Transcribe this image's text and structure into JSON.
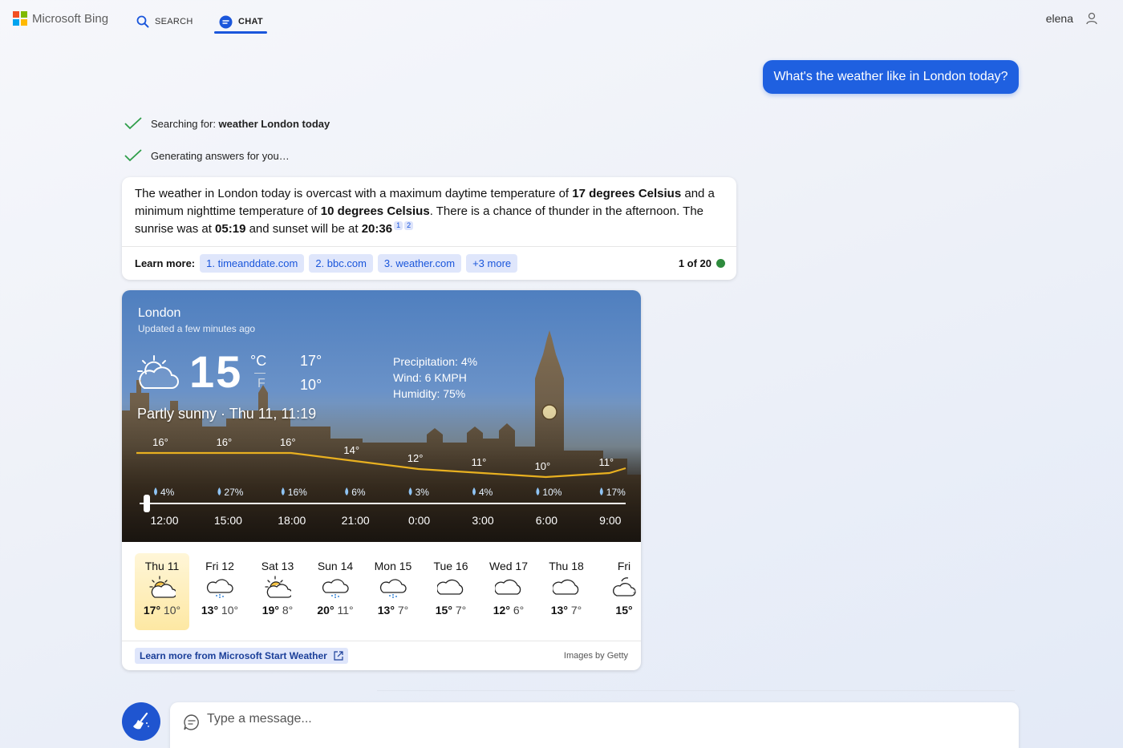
{
  "header": {
    "brand": "Microsoft Bing",
    "brand_colors": [
      "#f25022",
      "#7fba00",
      "#00a4ef",
      "#ffb900"
    ],
    "tabs": [
      {
        "label": "SEARCH",
        "icon": "search-icon"
      },
      {
        "label": "CHAT",
        "icon": "chat-icon",
        "active": true
      }
    ],
    "user_name": "elena"
  },
  "conversation": {
    "user_message": "What's the weather like in London today?",
    "status": [
      {
        "prefix": "Searching for: ",
        "bold": "weather London today"
      },
      {
        "prefix": "Generating answers for you…",
        "bold": ""
      }
    ],
    "answer": {
      "p1": "The weather in London today is overcast with a maximum daytime temperature of ",
      "b1": "17 degrees Celsius",
      "p2": " and a minimum nighttime temperature of ",
      "b2": "10 degrees Celsius",
      "p3": ". There is a chance of thunder in the afternoon. The sunrise was at ",
      "b3": "05:19",
      "p4": " and sunset will be at ",
      "b4": "20:36",
      "citations": [
        "1",
        "2"
      ]
    },
    "learn_more": {
      "label": "Learn more:",
      "links": [
        "1. timeanddate.com",
        "2. bbc.com",
        "3. weather.com",
        "+3 more"
      ],
      "pager": "1 of 20"
    }
  },
  "weather": {
    "city": "London",
    "updated": "Updated a few minutes ago",
    "temp": "15",
    "unit_c": "°C",
    "unit_f": "F",
    "high": "17°",
    "low": "10°",
    "precipitation": "Precipitation: 4%",
    "wind": "Wind: 6 KMPH",
    "humidity": "Humidity: 75%",
    "condition": "Partly sunny · Thu 11, 11:19",
    "hourly": {
      "times": [
        "12:00",
        "15:00",
        "18:00",
        "21:00",
        "0:00",
        "3:00",
        "6:00",
        "9:00"
      ],
      "temps_labels": [
        "16°",
        "16°",
        "16°",
        "14°",
        "12°",
        "11°",
        "10°",
        "11°"
      ],
      "temps": [
        16,
        16,
        16,
        14,
        12,
        11,
        10,
        11
      ],
      "precip": [
        "4%",
        "27%",
        "16%",
        "6%",
        "3%",
        "4%",
        "10%",
        "17%"
      ]
    },
    "daily": [
      {
        "day": "Thu 11",
        "hi": "17°",
        "lo": "10°",
        "icon": "partly-sunny-icon",
        "active": true
      },
      {
        "day": "Fri 12",
        "hi": "13°",
        "lo": "10°",
        "icon": "rain-cloud-icon"
      },
      {
        "day": "Sat 13",
        "hi": "19°",
        "lo": "8°",
        "icon": "partly-sunny-icon"
      },
      {
        "day": "Sun 14",
        "hi": "20°",
        "lo": "11°",
        "icon": "rain-cloud-icon"
      },
      {
        "day": "Mon 15",
        "hi": "13°",
        "lo": "7°",
        "icon": "rain-cloud-icon"
      },
      {
        "day": "Tue 16",
        "hi": "15°",
        "lo": "7°",
        "icon": "cloud-icon"
      },
      {
        "day": "Wed 17",
        "hi": "12°",
        "lo": "6°",
        "icon": "cloud-icon"
      },
      {
        "day": "Thu 18",
        "hi": "13°",
        "lo": "7°",
        "icon": "cloud-icon"
      },
      {
        "day": "Fri",
        "hi": "15°",
        "lo": "",
        "icon": "partly-cloudy-icon"
      }
    ],
    "footer_link": "Learn more from Microsoft Start Weather",
    "credit": "Images by Getty"
  },
  "composer": {
    "placeholder": "Type a message..."
  }
}
